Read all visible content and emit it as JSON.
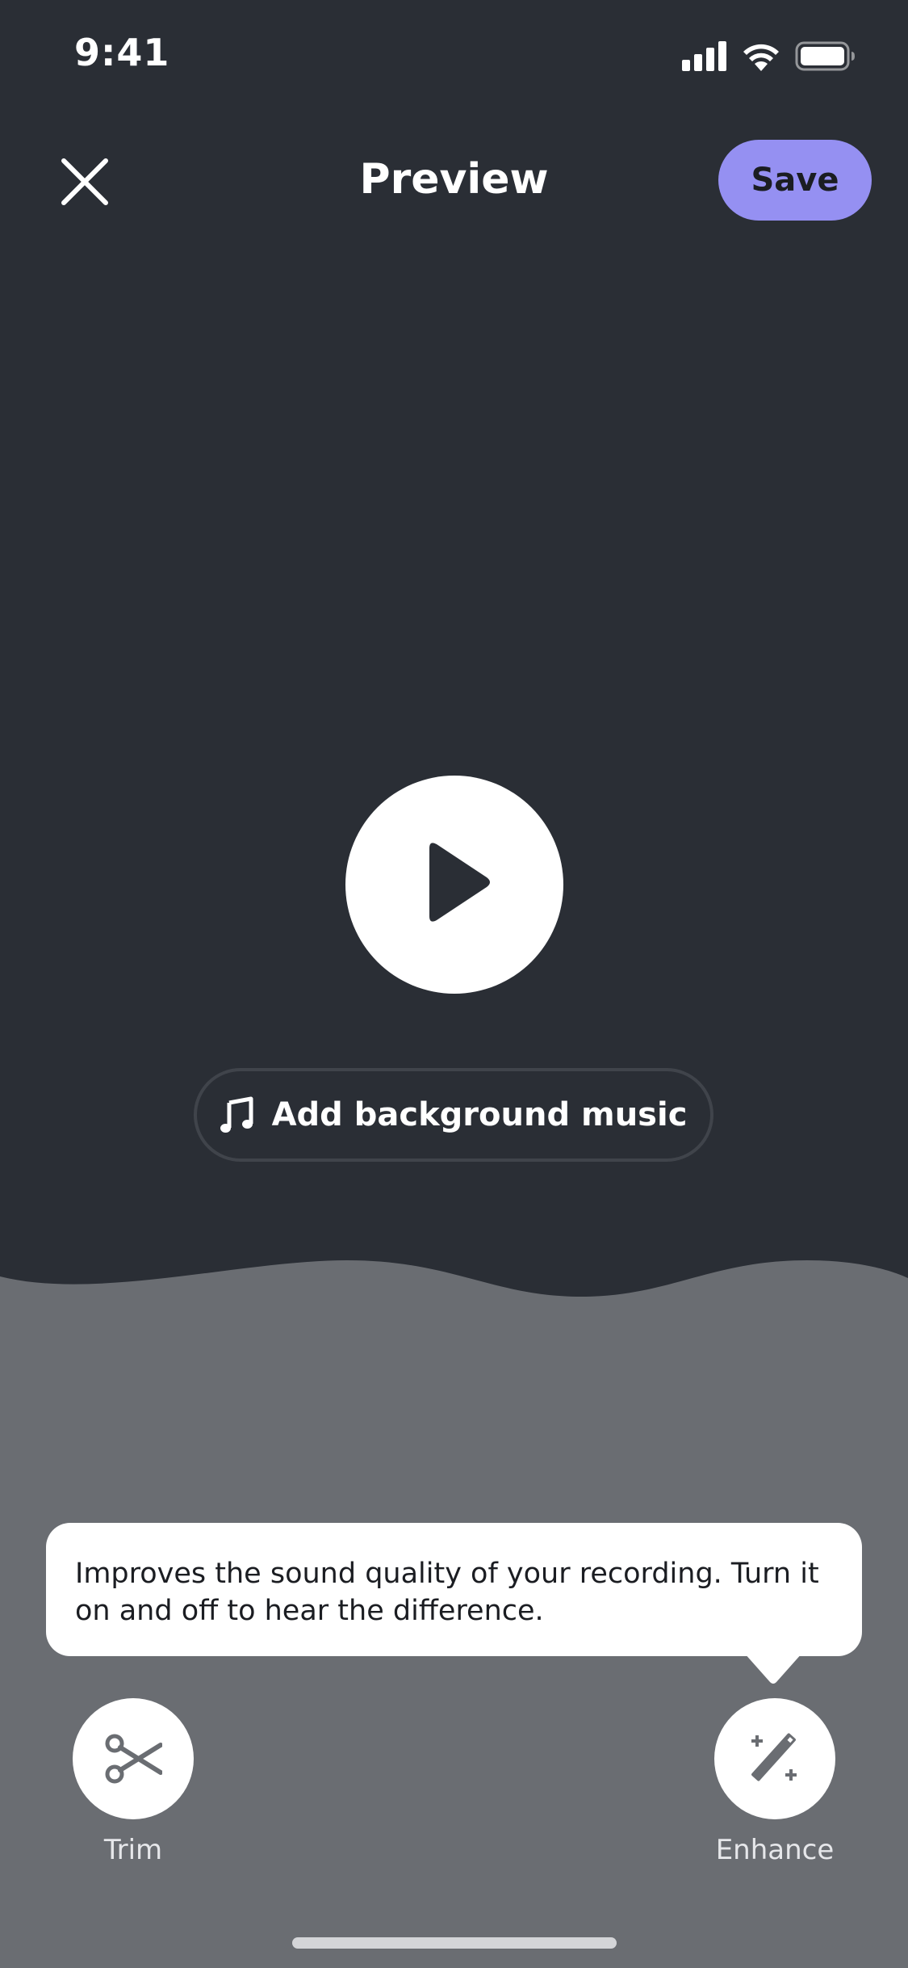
{
  "status_bar": {
    "time": "9:41",
    "icons": [
      "cellular-signal-icon",
      "wifi-icon",
      "battery-icon"
    ]
  },
  "header": {
    "title": "Preview",
    "close_icon": "close-icon",
    "save_label": "Save"
  },
  "player": {
    "play_icon": "play-icon"
  },
  "music": {
    "icon": "music-note-icon",
    "label": "Add background music"
  },
  "tooltip": {
    "text": "Improves the sound quality of your recording. Turn it on and off to hear the difference."
  },
  "tools": [
    {
      "label": "Trim",
      "icon": "scissors-icon"
    },
    {
      "label": "Enhance",
      "icon": "magic-wand-icon"
    }
  ],
  "colors": {
    "background": "#2a2e35",
    "bottom_panel": "#6a6d72",
    "accent": "#9590f2",
    "white": "#ffffff"
  }
}
